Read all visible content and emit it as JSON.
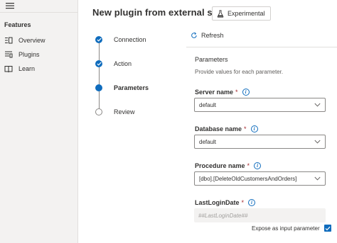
{
  "nav": {
    "section_label": "Features",
    "items": [
      {
        "label": "Overview",
        "icon": "overview-icon"
      },
      {
        "label": "Plugins",
        "icon": "plugins-icon"
      },
      {
        "label": "Learn",
        "icon": "book-icon"
      }
    ]
  },
  "header": {
    "title": "New plugin from external service",
    "badge_label": "Experimental"
  },
  "stepper": {
    "steps": [
      {
        "label": "Connection",
        "state": "done"
      },
      {
        "label": "Action",
        "state": "done"
      },
      {
        "label": "Parameters",
        "state": "active"
      },
      {
        "label": "Review",
        "state": "todo"
      }
    ]
  },
  "toolbar": {
    "refresh_label": "Refresh"
  },
  "parameters": {
    "title": "Parameters",
    "description": "Provide values for each parameter.",
    "server": {
      "label": "Server name",
      "required_mark": "*",
      "value": "default"
    },
    "database": {
      "label": "Database name",
      "required_mark": "*",
      "value": "default"
    },
    "procedure": {
      "label": "Procedure name",
      "required_mark": "*",
      "value": "[dbo].[DeleteOldCustomersAndOrders]"
    },
    "last_login": {
      "label": "LastLoginDate",
      "required_mark": "*",
      "placeholder": "##LastLoginDate##"
    },
    "expose_label": "Expose as input parameter",
    "expose_checked": true
  },
  "colors": {
    "accent": "#0f6cbd",
    "required": "#a4262c",
    "nav_background": "#f3f2f1"
  }
}
